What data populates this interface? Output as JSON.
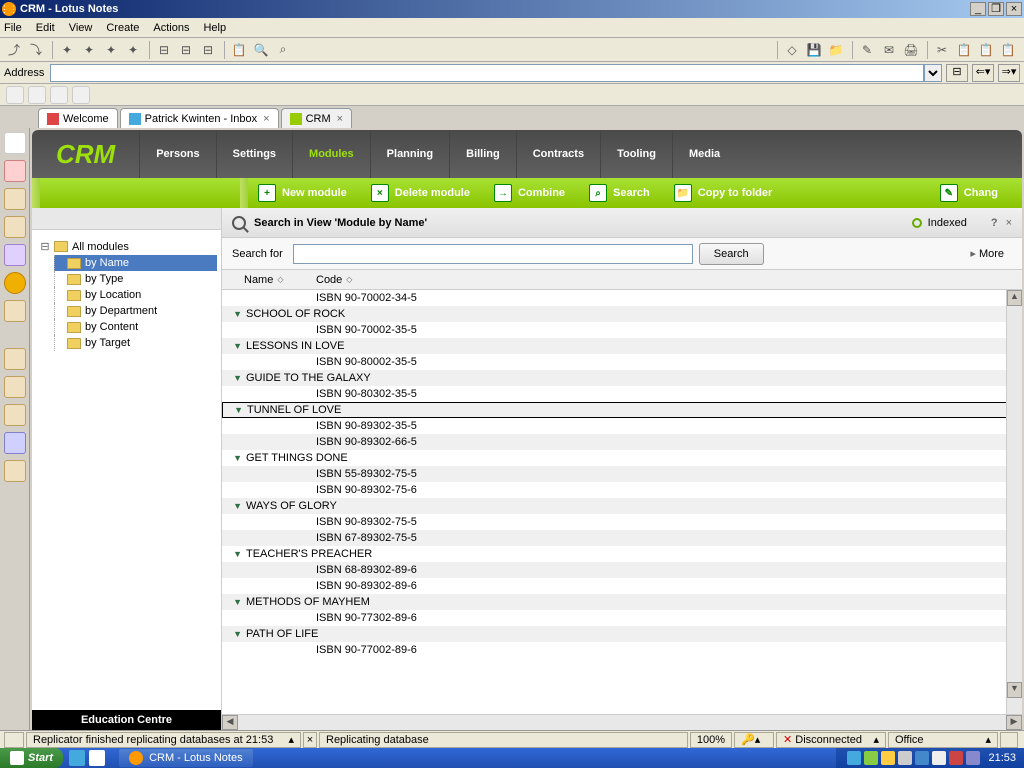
{
  "window": {
    "title": "CRM - Lotus Notes"
  },
  "menus": [
    "File",
    "Edit",
    "View",
    "Create",
    "Actions",
    "Help"
  ],
  "addressbar": {
    "label": "Address"
  },
  "tabs": [
    {
      "label": "Welcome",
      "icon": "home-icon",
      "closable": false
    },
    {
      "label": "Patrick Kwinten - Inbox",
      "icon": "mail-icon",
      "closable": true
    },
    {
      "label": "CRM",
      "icon": "app-icon",
      "closable": true,
      "active": true
    }
  ],
  "app": {
    "logo": "CRM"
  },
  "nav": [
    {
      "label": "Persons"
    },
    {
      "label": "Settings"
    },
    {
      "label": "Modules",
      "active": true
    },
    {
      "label": "Planning"
    },
    {
      "label": "Billing"
    },
    {
      "label": "Contracts"
    },
    {
      "label": "Tooling"
    },
    {
      "label": "Media"
    }
  ],
  "actions": [
    {
      "label": "New module",
      "icon": "+"
    },
    {
      "label": "Delete module",
      "icon": "×"
    },
    {
      "label": "Combine",
      "icon": "→"
    },
    {
      "label": "Search",
      "icon": "⌕"
    },
    {
      "label": "Copy to folder",
      "icon": "📁"
    },
    {
      "label": "Chang",
      "icon": "✎"
    }
  ],
  "tree": {
    "root": "All modules",
    "items": [
      {
        "label": "by Name",
        "selected": true
      },
      {
        "label": "by Type"
      },
      {
        "label": "by Location"
      },
      {
        "label": "by Department"
      },
      {
        "label": "by Content"
      },
      {
        "label": "by Target"
      }
    ],
    "footer": "Education Centre"
  },
  "search": {
    "title": "Search in View 'Module by Name'",
    "indexed": "Indexed",
    "label": "Search for",
    "button": "Search",
    "more": "More",
    "help": "?",
    "close": "×"
  },
  "grid": {
    "cols": {
      "name": "Name",
      "code": "Code"
    },
    "rows": [
      {
        "t": "code",
        "v": "ISBN 90-70002-34-5"
      },
      {
        "t": "cat",
        "v": "SCHOOL OF ROCK"
      },
      {
        "t": "code",
        "v": "ISBN 90-70002-35-5"
      },
      {
        "t": "cat",
        "v": "LESSONS IN LOVE"
      },
      {
        "t": "code",
        "v": "ISBN 90-80002-35-5"
      },
      {
        "t": "cat",
        "v": "GUIDE TO THE GALAXY"
      },
      {
        "t": "code",
        "v": "ISBN 90-80302-35-5"
      },
      {
        "t": "cat",
        "v": "TUNNEL OF LOVE",
        "sel": true
      },
      {
        "t": "code",
        "v": "ISBN 90-89302-35-5"
      },
      {
        "t": "code",
        "v": "ISBN 90-89302-66-5"
      },
      {
        "t": "cat",
        "v": "GET THINGS DONE"
      },
      {
        "t": "code",
        "v": "ISBN 55-89302-75-5"
      },
      {
        "t": "code",
        "v": "ISBN 90-89302-75-6"
      },
      {
        "t": "cat",
        "v": "WAYS OF GLORY"
      },
      {
        "t": "code",
        "v": "ISBN 90-89302-75-5"
      },
      {
        "t": "code",
        "v": "ISBN 67-89302-75-5"
      },
      {
        "t": "cat",
        "v": "TEACHER'S PREACHER"
      },
      {
        "t": "code",
        "v": "ISBN 68-89302-89-6"
      },
      {
        "t": "code",
        "v": "ISBN 90-89302-89-6"
      },
      {
        "t": "cat",
        "v": "METHODS OF MAYHEM"
      },
      {
        "t": "code",
        "v": "ISBN 90-77302-89-6"
      },
      {
        "t": "cat",
        "v": "PATH OF LIFE"
      },
      {
        "t": "code",
        "v": "ISBN 90-77002-89-6"
      }
    ]
  },
  "status": {
    "replicator": "Replicator finished replicating databases at 21:53",
    "x": "×",
    "replicating": "Replicating database",
    "zoom": "100%",
    "conn": "Disconnected",
    "loc": "Office"
  },
  "taskbar": {
    "start": "Start",
    "app": "CRM - Lotus Notes",
    "clock": "21:53"
  }
}
